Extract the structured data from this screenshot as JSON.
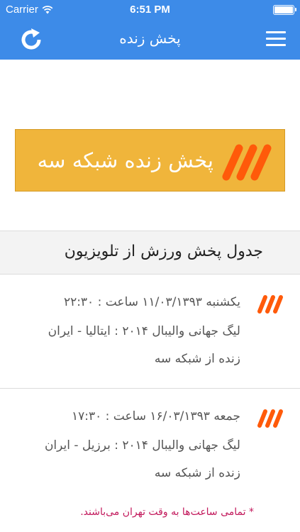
{
  "status_bar": {
    "carrier": "Carrier",
    "time": "6:51 PM"
  },
  "nav": {
    "title": "پخش زنده"
  },
  "banner": {
    "text": "پخش زنده شبکه سه",
    "accent_color": "#f0b53b",
    "logo_color": "#ff5a0a"
  },
  "schedule": {
    "header": "جدول پخش ورزش از تلویزیون",
    "items": [
      {
        "datetime": "یکشنبه ۱۱/۰۳/۱۳۹۳ ساعت : ۲۲:۳۰",
        "match": "لیگ جهانی والیبال ۲۰۱۴ : ایتالیا - ایران",
        "channel": "زنده از شبکه سه"
      },
      {
        "datetime": "جمعه ۱۶/۰۳/۱۳۹۳ ساعت : ۱۷:۳۰",
        "match": "لیگ جهانی والیبال ۲۰۱۴ : برزیل - ایران",
        "channel": "زنده از شبکه سه"
      }
    ]
  },
  "footnote": "* تمامی ساعت‌ها به وقت تهران می‌باشند."
}
